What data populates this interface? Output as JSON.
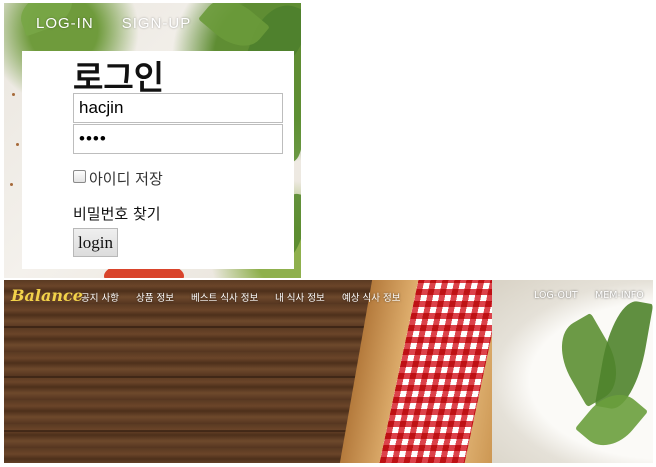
{
  "top_nav": {
    "login": "LOG-IN",
    "signup": "SIGN-UP"
  },
  "login_form": {
    "title": "로그인",
    "username_value": "hacjin",
    "password_masked": "••••",
    "save_id_label": "아이디 저장",
    "save_id_checked": false,
    "find_password": "비밀번호 찾기",
    "submit_label": "login"
  },
  "main_nav": {
    "brand": "Balance",
    "items": [
      "공지 사항",
      "상품 정보",
      "베스트 식사 정보",
      "내 식사 정보",
      "예상 식사 정보"
    ],
    "right_items": [
      "LOG-OUT",
      "MEM-INFO"
    ]
  },
  "colors": {
    "brand": "#f2d24a",
    "nav_text": "#ffffff"
  }
}
